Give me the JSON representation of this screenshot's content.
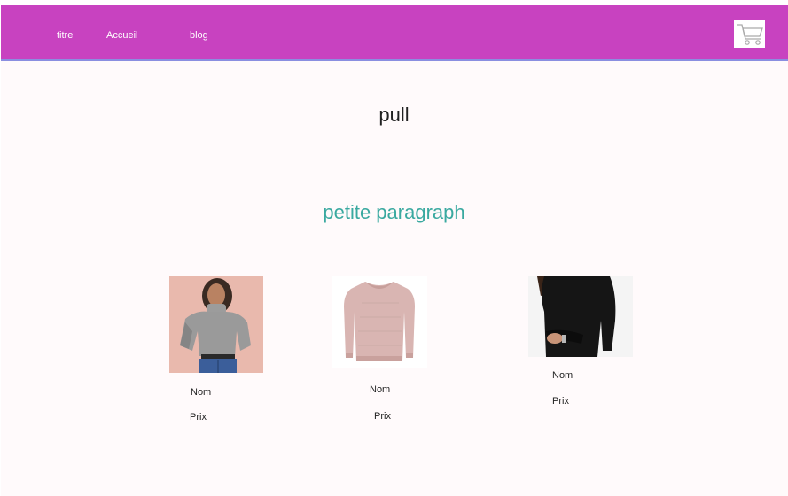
{
  "nav": {
    "links": [
      "titre",
      "Accueil",
      "blog"
    ],
    "background_color": "#c842c0",
    "cart_icon": "shopping-cart-icon"
  },
  "main": {
    "title": "pull",
    "subtitle": "petite paragraph",
    "subtitle_color": "#3aa9a0"
  },
  "products": [
    {
      "name_label": "Nom",
      "price_label": "Prix",
      "image": "grey-turtleneck-sweater-photo"
    },
    {
      "name_label": "Nom",
      "price_label": "Prix",
      "image": "pink-knit-sweater-photo"
    },
    {
      "name_label": "Nom",
      "price_label": "Prix",
      "image": "black-sweater-photo"
    }
  ]
}
